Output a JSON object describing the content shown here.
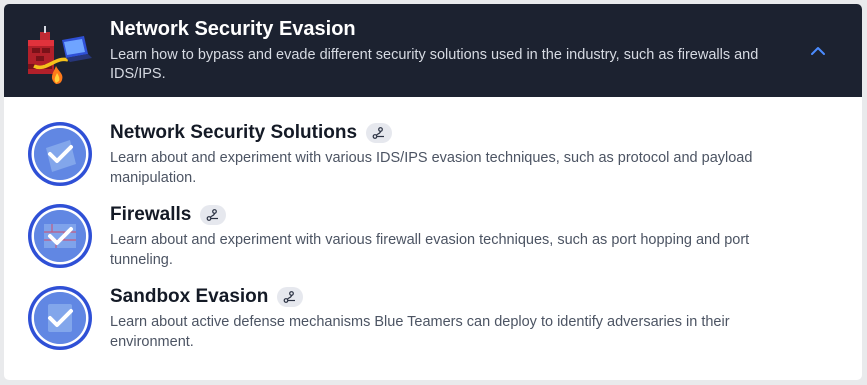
{
  "module": {
    "title": "Network Security Evasion",
    "description": "Learn how to bypass and evade different security solutions used in the industry, such as firewalls and IDS/IPS.",
    "icon": "network-evasion-illustration",
    "expanded": true,
    "chevron_icon": "chevron-up-icon"
  },
  "rooms": [
    {
      "title": "Network Security Solutions",
      "description": "Learn about and experiment with various IDS/IPS evasion techniques, such as protocol and payload manipulation.",
      "icon": "room-completed-check-icon",
      "badge_icon": "path-icon"
    },
    {
      "title": "Firewalls",
      "description": "Learn about and experiment with various firewall evasion techniques, such as port hopping and port tunneling.",
      "icon": "room-completed-check-icon",
      "badge_icon": "path-icon"
    },
    {
      "title": "Sandbox Evasion",
      "description": "Learn about active defense mechanisms Blue Teamers can deploy to identify adversaries in their environment.",
      "icon": "room-completed-check-icon",
      "badge_icon": "path-icon"
    }
  ],
  "colors": {
    "header_bg": "#1c2230",
    "accent_blue": "#2f50d6",
    "title_text": "#141a26",
    "body_text": "#4c5463"
  }
}
